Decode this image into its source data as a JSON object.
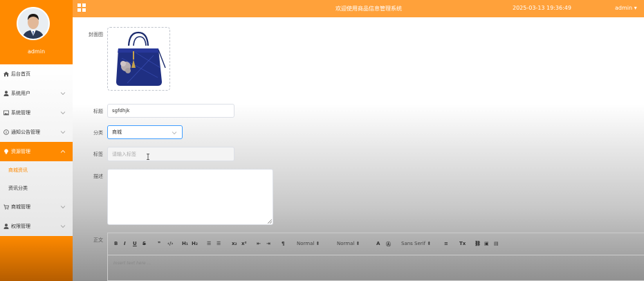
{
  "sidebar": {
    "username": "admin",
    "items": [
      {
        "label": "后台首页"
      },
      {
        "label": "系统用户"
      },
      {
        "label": "系统管理"
      },
      {
        "label": "通知公告管理"
      },
      {
        "label": "资源管理"
      },
      {
        "label": "商城管理"
      },
      {
        "label": "权限管理"
      }
    ],
    "subitems": [
      {
        "label": "商城资讯"
      },
      {
        "label": "资讯分类"
      }
    ]
  },
  "header": {
    "title": "欢迎使用商品信息管理系统",
    "datetime": "2025-03-13 19:36:49",
    "user": "admin"
  },
  "form": {
    "cover_label": "封面图",
    "title_label": "标题",
    "title_value": "sgfdhjk",
    "category_label": "分类",
    "category_value": "商城",
    "tag_label": "标签",
    "tag_placeholder": "请输入标签",
    "desc_label": "描述",
    "body_label": "正文"
  },
  "editor": {
    "header_select": "Normal",
    "size_select": "Normal",
    "font_select": "Sans Serif",
    "placeholder": "Insert text here ..."
  },
  "colors": {
    "sidebar": "#ff8a00",
    "header": "#ffa13a",
    "focus": "#409eff"
  }
}
